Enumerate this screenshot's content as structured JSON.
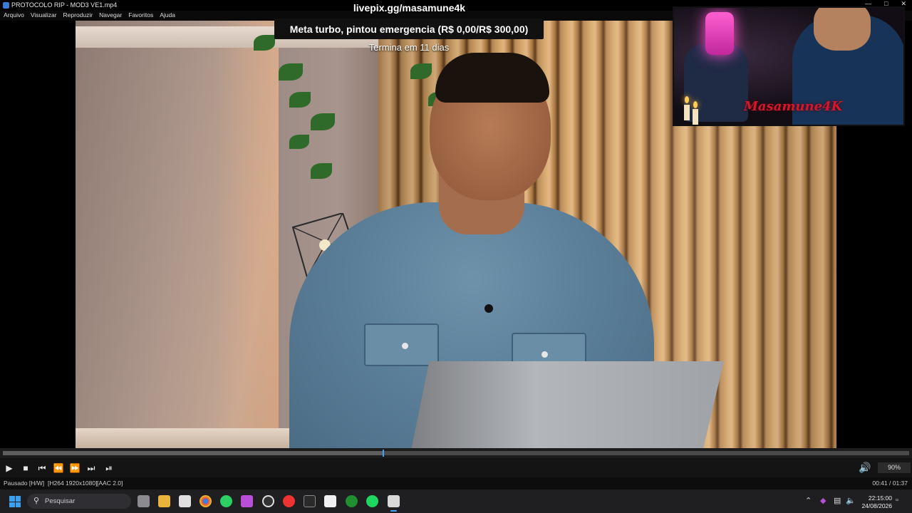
{
  "window": {
    "title": "PROTOCOLO RIP - MOD3 VE1.mp4"
  },
  "menu": [
    "Arquivo",
    "Visualizar",
    "Reproduzir",
    "Navegar",
    "Favoritos",
    "Ajuda"
  ],
  "overlay": {
    "url": "livepix.gg/masamune4k",
    "goal": "Meta turbo, pintou emergencia (R$ 0,00/R$ 300,00)",
    "goal_sub": "Termina em 11 dias",
    "webcam_brand": "Masamune4K"
  },
  "player": {
    "seek_progress": 0.42,
    "volume": "90%",
    "status": "Pausado [H/W]",
    "video_info": "[H264 1920x1080]",
    "audio_info": "[AAC 2.0]",
    "time": "00:41 / 01:37"
  },
  "taskbar": {
    "search_placeholder": "Pesquisar",
    "clock_time": "22:15:00",
    "clock_date": "24/08/2026",
    "accent": "#3ca0f0"
  }
}
